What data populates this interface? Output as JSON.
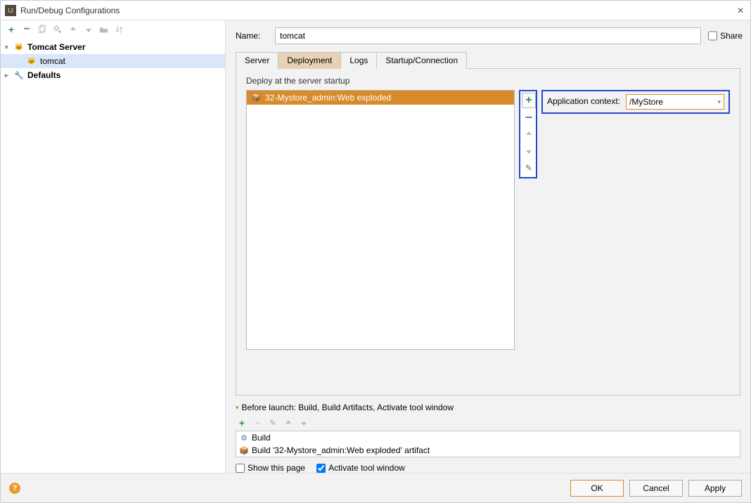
{
  "window": {
    "title": "Run/Debug Configurations"
  },
  "tree": {
    "root": "Tomcat Server",
    "child": "tomcat",
    "defaults": "Defaults"
  },
  "name": {
    "label": "Name:",
    "value": "tomcat",
    "share": "Share"
  },
  "tabs": [
    "Server",
    "Deployment",
    "Logs",
    "Startup/Connection"
  ],
  "deploy": {
    "label": "Deploy at the server startup",
    "artifact": "32-Mystore_admin:Web exploded",
    "context_label": "Application context:",
    "context_value": "/MyStore"
  },
  "before_launch": {
    "header": "Before launch: Build, Build Artifacts, Activate tool window",
    "items": [
      "Build",
      "Build '32-Mystore_admin:Web exploded' artifact"
    ],
    "show_page": "Show this page",
    "activate": "Activate tool window"
  },
  "buttons": {
    "ok": "OK",
    "cancel": "Cancel",
    "apply": "Apply"
  }
}
